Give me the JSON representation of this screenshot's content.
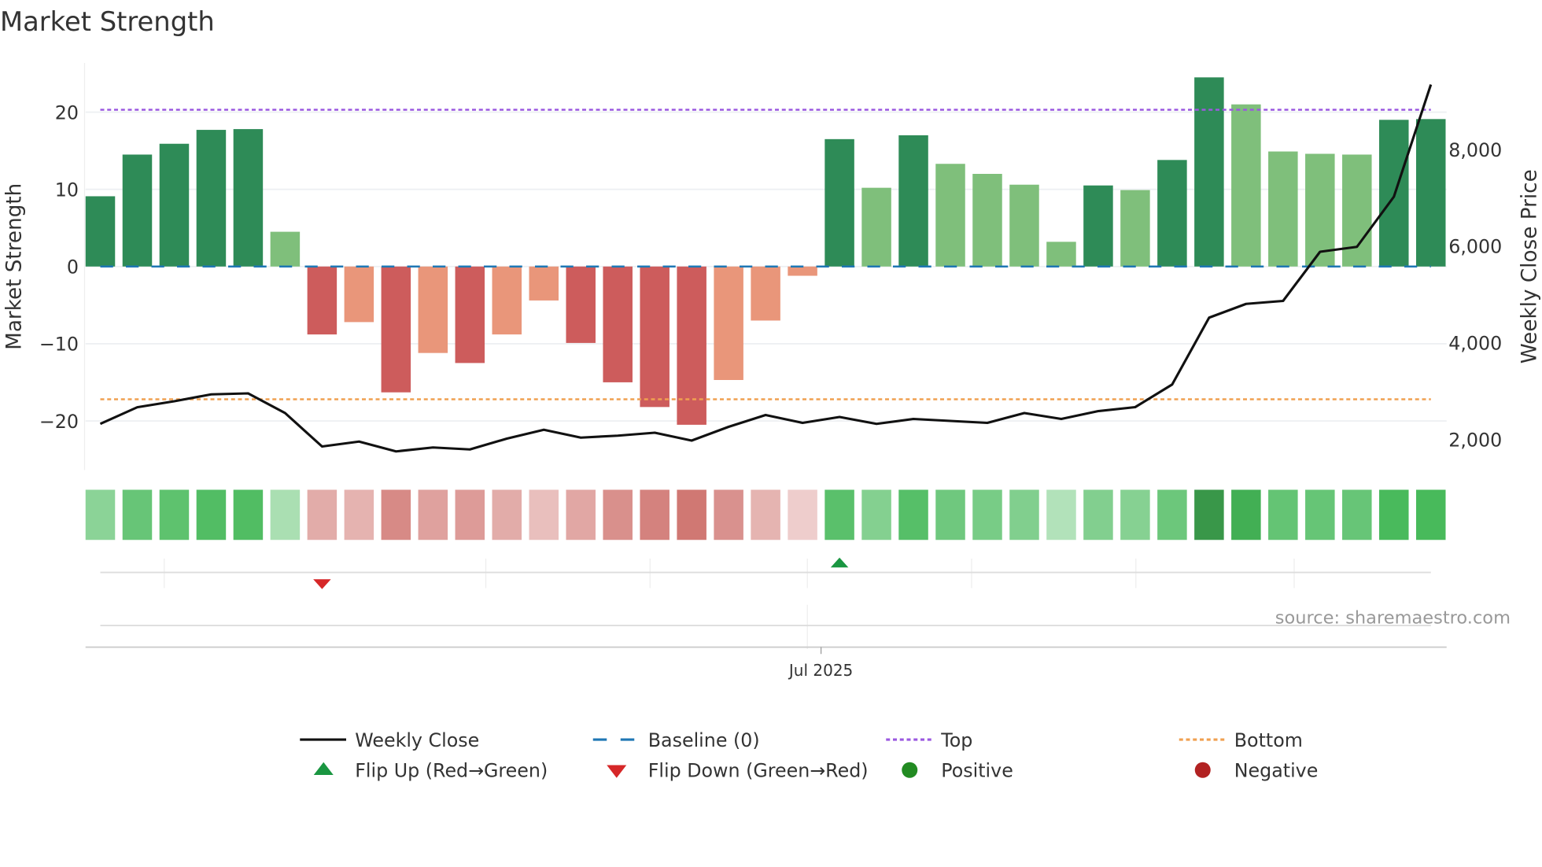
{
  "chart_data": {
    "type": "bar",
    "title": "Market Strength",
    "ylabel": "Market Strength",
    "y2label": "Weekly Close Price",
    "ylim": [
      -26.5,
      26.5
    ],
    "y2lim": [
      1350,
      9900
    ],
    "yticks": [
      20,
      10,
      0,
      -10,
      -20
    ],
    "ytick_labels": [
      "20",
      "10",
      "0",
      "−10",
      "−20"
    ],
    "y2ticks": [
      8000,
      6000,
      4000,
      2000
    ],
    "y2tick_labels": [
      "8,000",
      "6,000",
      "4,000",
      "2,000"
    ],
    "xtick_label": "Jul 2025",
    "xtick_index": 19.5,
    "strength": [
      9.1,
      14.5,
      15.9,
      17.7,
      17.8,
      4.5,
      -8.8,
      -7.2,
      -16.3,
      -11.2,
      -12.5,
      -8.8,
      -4.4,
      -9.9,
      -15.0,
      -18.2,
      -20.5,
      -14.7,
      -7.0,
      -1.2,
      16.5,
      10.2,
      17.0,
      13.3,
      12.0,
      10.6,
      3.2,
      10.5,
      9.9,
      13.8,
      24.5,
      21.0,
      14.9,
      14.6,
      14.5,
      19.0,
      19.1
    ],
    "weekly_close": [
      2325,
      2670,
      2793,
      2935,
      2956,
      2549,
      1858,
      1959,
      1756,
      1837,
      1797,
      2020,
      2203,
      2041,
      2081,
      2142,
      1980,
      2264,
      2508,
      2346,
      2468,
      2325,
      2427,
      2386,
      2346,
      2549,
      2427,
      2590,
      2671,
      3139,
      4522,
      4807,
      4868,
      5885,
      5986,
      7023,
      9342
    ],
    "top": 20.3,
    "bottom": -17.2,
    "baseline": 0,
    "flip_up_index": [
      20
    ],
    "flip_down_index": [
      6
    ],
    "legend": {
      "placement": "bottom",
      "items": [
        "Weekly Close",
        "Baseline (0)",
        "Top",
        "Bottom",
        "Flip Up (Red→Green)",
        "Flip Down (Green→Red)",
        "Positive",
        "Negative"
      ]
    },
    "source": "source: sharemaestro.com",
    "colors": {
      "pos_strong": "#2e8b57",
      "pos_weak": "#7fbf7b",
      "neg_strong": "#cd5c5c",
      "neg_weak": "#e9967a",
      "line": "#111111",
      "baseline": "#1f77b4",
      "top": "#9b59e0",
      "bottom": "#f0a050",
      "flip_up": "#1a9641",
      "flip_down": "#d62728",
      "positive_dot": "#228b22",
      "negative_dot": "#b22222"
    }
  }
}
